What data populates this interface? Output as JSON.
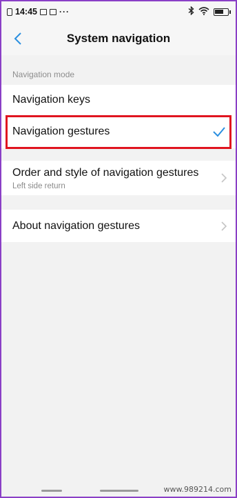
{
  "status_bar": {
    "time": "14:45",
    "dots": "···",
    "battery_level": 0.7
  },
  "header": {
    "title": "System navigation",
    "back_icon": "chevron-left-icon"
  },
  "section": {
    "label": "Navigation mode"
  },
  "options": [
    {
      "label": "Navigation keys"
    },
    {
      "label": "Navigation gestures",
      "selected": true
    }
  ],
  "gesture_style": {
    "label": "Order and style of navigation gestures",
    "sublabel": "Left side return"
  },
  "about": {
    "label": "About navigation gestures"
  },
  "watermark": "www.989214.com",
  "colors": {
    "accent": "#2a8fe0",
    "highlight": "#e0141f",
    "frame": "#8a3fc6"
  }
}
